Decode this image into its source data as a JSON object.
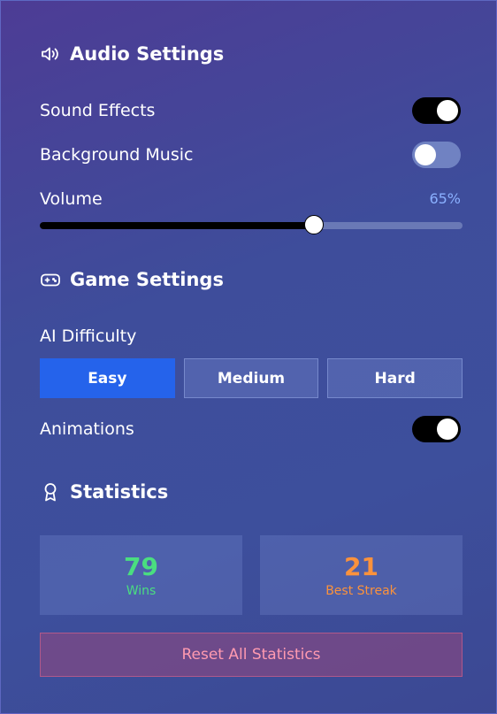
{
  "audio": {
    "title": "Audio Settings",
    "icon": "speaker-icon",
    "sound_effects": {
      "label": "Sound Effects",
      "on": true
    },
    "background_music": {
      "label": "Background Music",
      "on": false
    },
    "volume": {
      "label": "Volume",
      "display": "65%",
      "level": 0.65
    }
  },
  "game": {
    "title": "Game Settings",
    "icon": "gamepad-icon",
    "difficulty": {
      "label": "AI Difficulty",
      "options": [
        "Easy",
        "Medium",
        "Hard"
      ],
      "selected": "Easy"
    },
    "animations": {
      "label": "Animations",
      "on": true
    }
  },
  "statistics": {
    "title": "Statistics",
    "icon": "award-icon",
    "wins": {
      "value": "79",
      "label": "Wins",
      "color": "#4ade80"
    },
    "best_streak": {
      "value": "21",
      "label": "Best Streak",
      "color": "#fb923c"
    },
    "reset_label": "Reset All Statistics"
  },
  "colors": {
    "accent": "#2563eb",
    "volume_text": "#8ab0ff",
    "reset_text": "#ff9ab0"
  }
}
